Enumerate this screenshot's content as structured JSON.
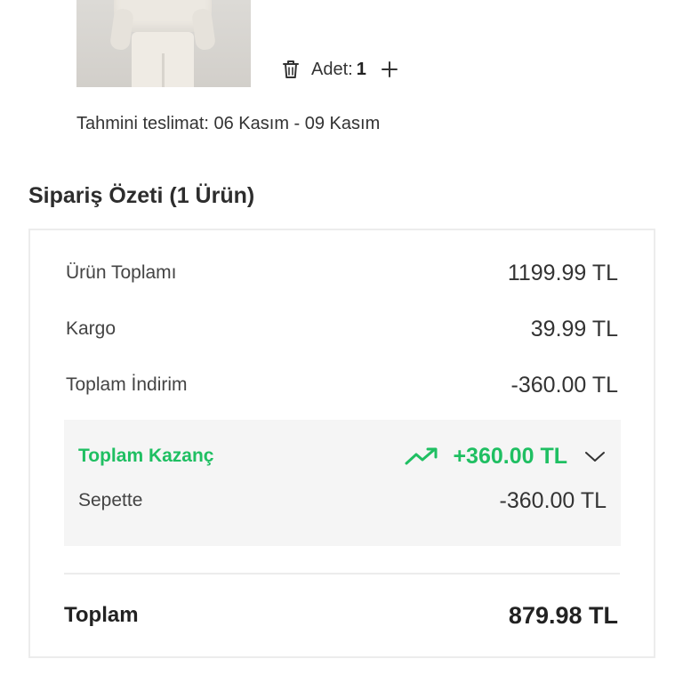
{
  "product": {
    "image_icon": "product-photo-icon",
    "quantity_label": "Adet:",
    "quantity_value": "1",
    "delete_icon": "trash-icon",
    "increment_icon": "plus-icon"
  },
  "delivery": {
    "text": "Tahmini teslimat: 06 Kasım - 09 Kasım"
  },
  "summary": {
    "title": "Sipariş Özeti (1 Ürün)",
    "rows": [
      {
        "label": "Ürün Toplamı",
        "value": "1199.99 TL"
      },
      {
        "label": "Kargo",
        "value": "39.99 TL"
      },
      {
        "label": "Toplam İndirim",
        "value": "-360.00 TL"
      }
    ],
    "savings": {
      "title": "Toplam Kazanç",
      "amount": "+360.00 TL",
      "trend_icon": "trend-up-icon",
      "toggle_icon": "chevron-down-icon",
      "sub_label": "Sepette",
      "sub_value": "-360.00 TL"
    },
    "total": {
      "label": "Toplam",
      "value": "879.98 TL"
    }
  },
  "colors": {
    "accent_green": "#1fbf62",
    "text": "#333333",
    "border": "#ececec",
    "savings_bg": "#f5f5f5"
  }
}
